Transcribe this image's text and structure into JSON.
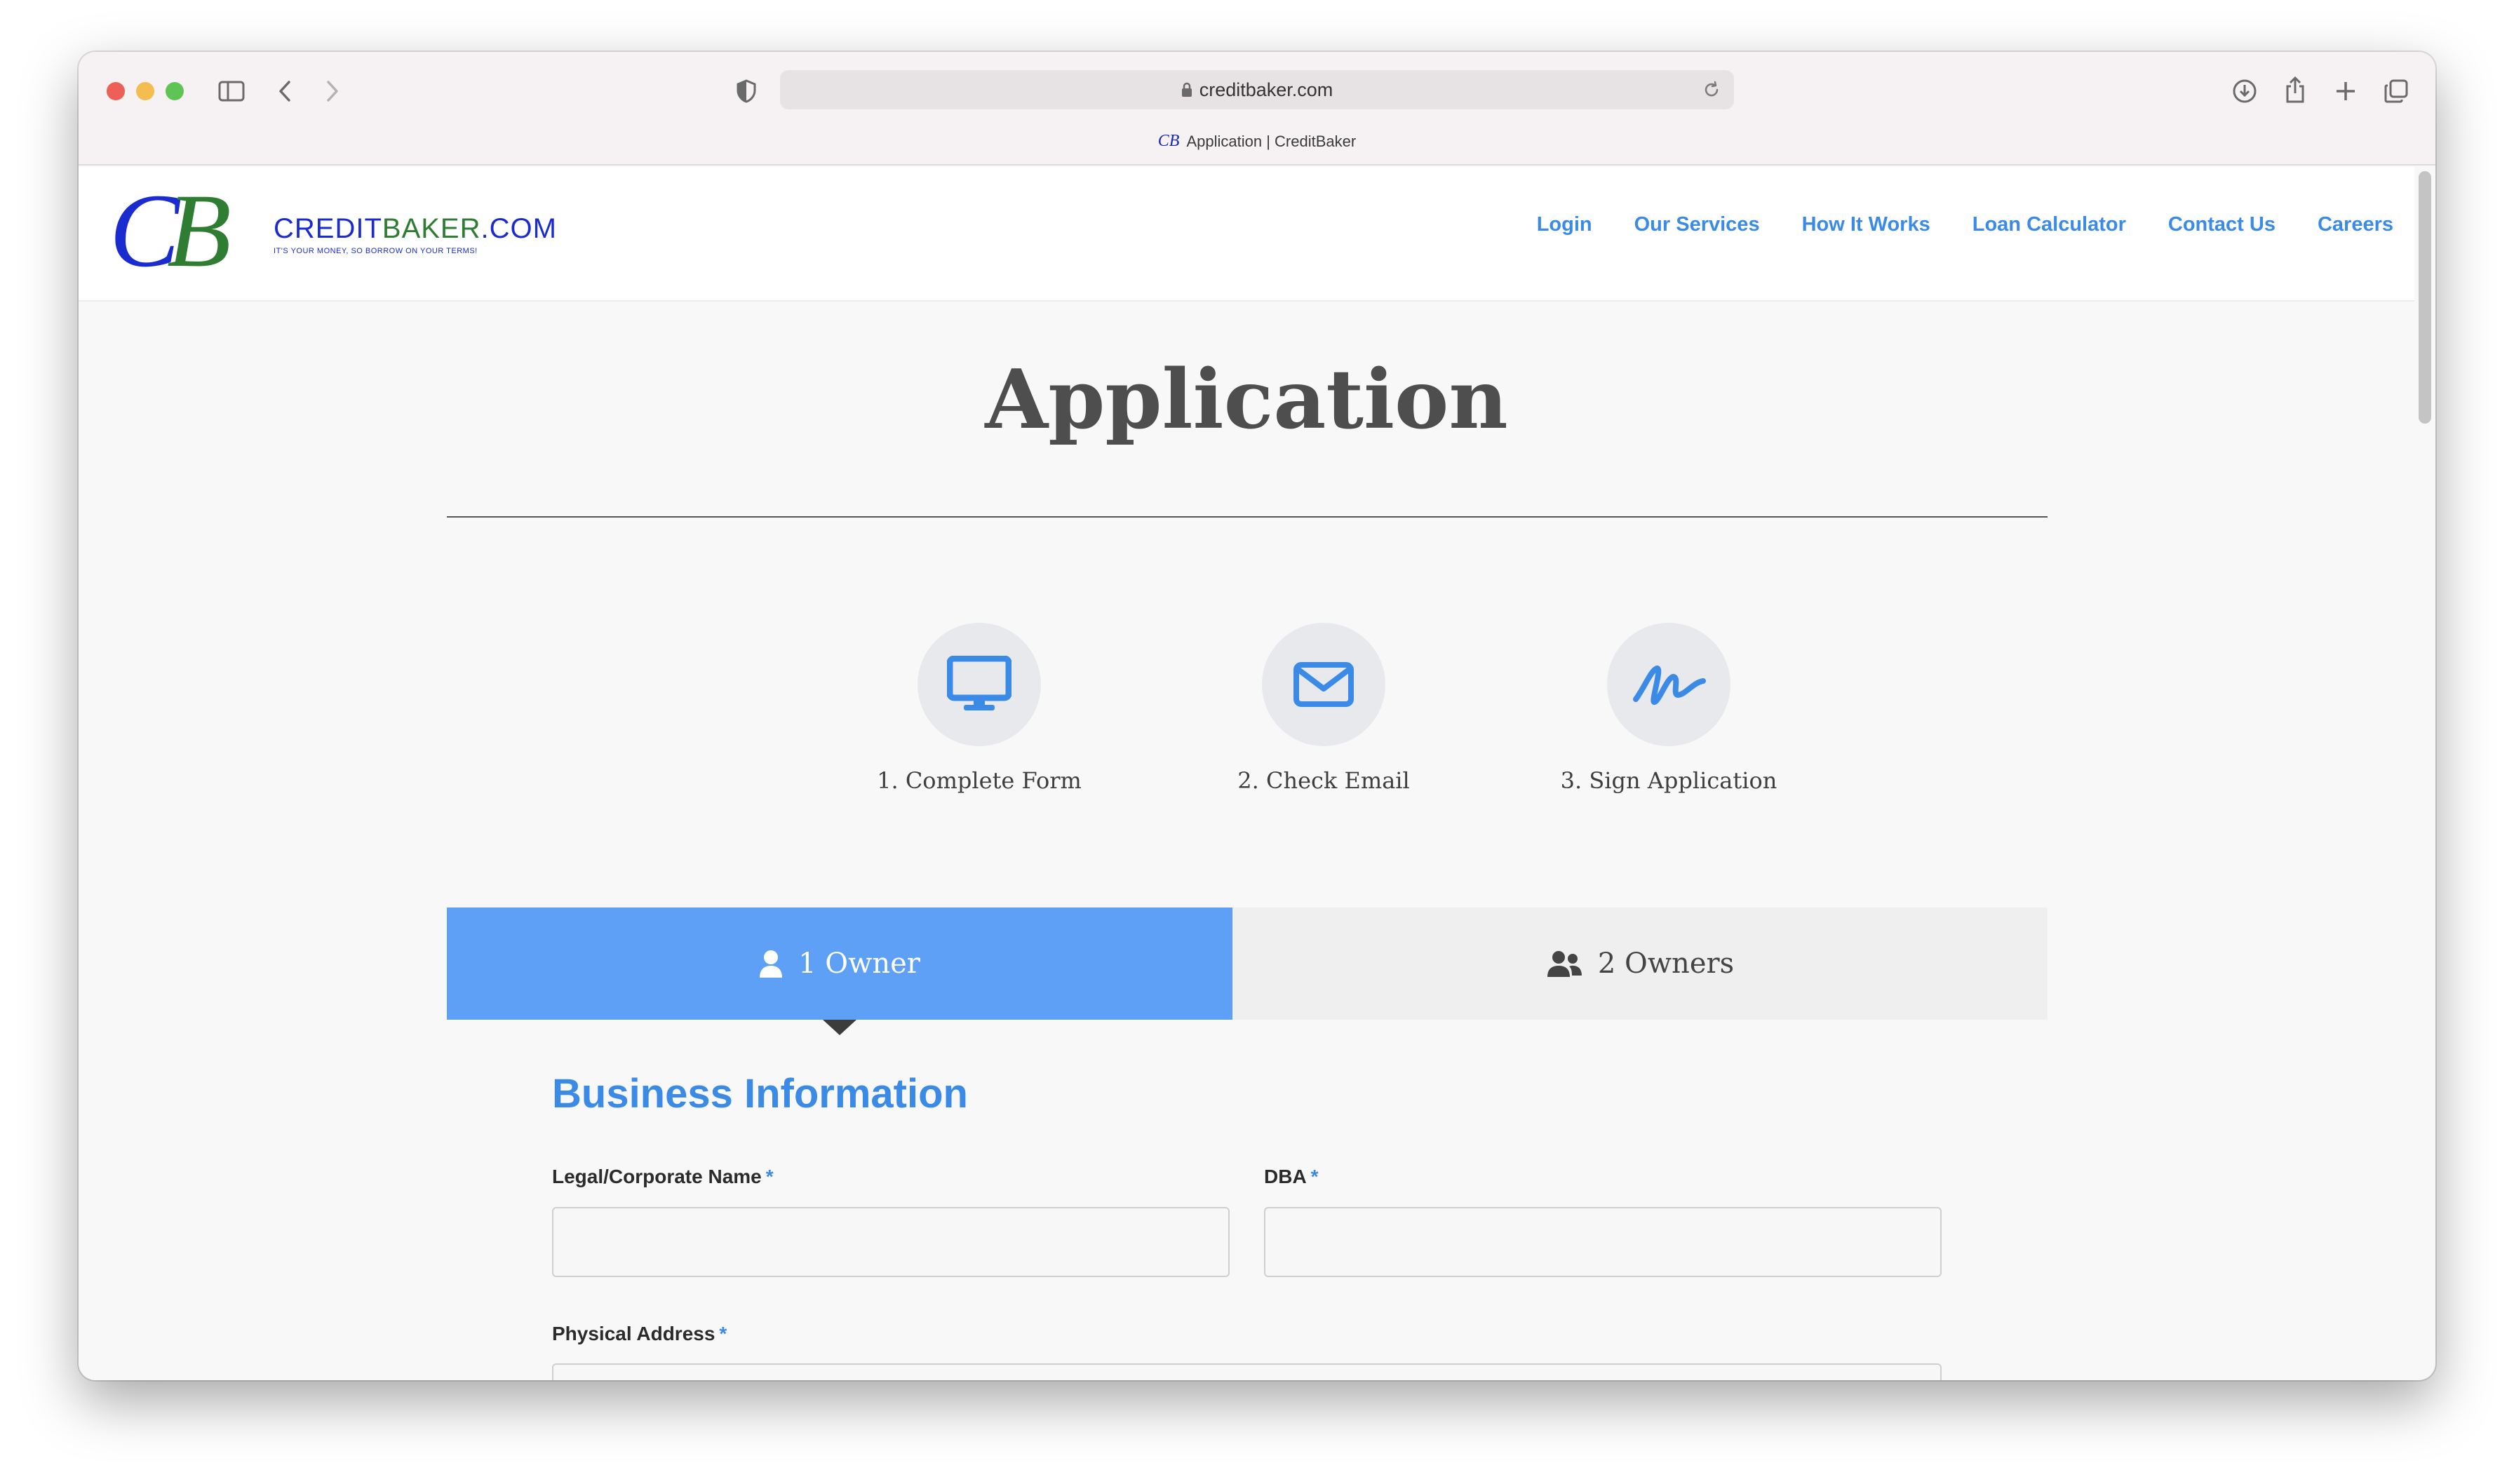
{
  "browser": {
    "url": "creditbaker.com",
    "tab_favicon": "CB",
    "tab_title": "Application | CreditBaker",
    "icons": [
      "sidebar-icon",
      "back-icon",
      "forward-icon",
      "shield-icon",
      "lock-icon",
      "reload-icon",
      "download-icon",
      "share-icon",
      "new-tab-icon",
      "tabs-overview-icon"
    ]
  },
  "logo": {
    "monogram_c": "C",
    "monogram_b": "B",
    "credit": "CREDIT",
    "baker": "BAKER",
    "dotcom": ".COM",
    "tagline": "IT'S YOUR MONEY, SO BORROW ON YOUR TERMS!"
  },
  "nav": {
    "items": [
      "Login",
      "Our Services",
      "How It Works",
      "Loan Calculator",
      "Contact Us",
      "Careers"
    ]
  },
  "page": {
    "title": "Application"
  },
  "steps": [
    {
      "label": "1. Complete Form",
      "icon": "desktop-icon"
    },
    {
      "label": "2. Check Email",
      "icon": "envelope-icon"
    },
    {
      "label": "3. Sign Application",
      "icon": "signature-icon"
    }
  ],
  "owner_tabs": [
    {
      "label": "1 Owner",
      "icon": "user-icon",
      "active": true
    },
    {
      "label": "2 Owners",
      "icon": "users-icon",
      "active": false
    }
  ],
  "form": {
    "section_title": "Business Information",
    "required_marker": "*",
    "fields": {
      "legal_name": {
        "label": "Legal/Corporate Name",
        "value": ""
      },
      "dba": {
        "label": "DBA",
        "value": ""
      },
      "physical_address": {
        "label": "Physical Address",
        "value": ""
      }
    }
  },
  "colors": {
    "accent": "#3b8be6",
    "active_tab": "#5ea0f5",
    "logo_blue": "#1a2bd0",
    "logo_green": "#2e7d32"
  }
}
